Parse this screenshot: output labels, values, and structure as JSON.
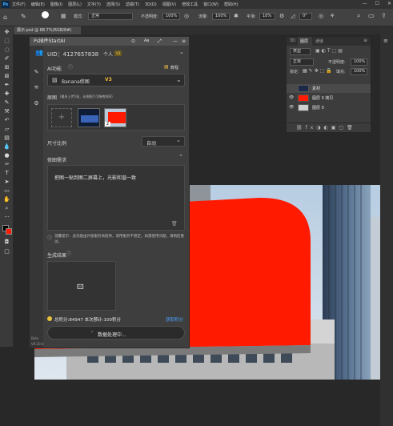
{
  "menubar": {
    "items": [
      "文件(F)",
      "编辑(E)",
      "图像(I)",
      "图层(L)",
      "文字(Y)",
      "选择(S)",
      "滤镜(T)",
      "3D(D)",
      "视图(V)",
      "增效工具",
      "窗口(W)",
      "帮助(H)"
    ],
    "logo": "Ps"
  },
  "options": {
    "mode_label": "模式:",
    "mode_value": "正常",
    "opacity_label": "不透明度:",
    "opacity_value": "100%",
    "flow_label": "流量:",
    "flow_value": "100%",
    "smooth_label": "平滑:",
    "smooth_value": "10%",
    "angle_value": "0°"
  },
  "document": {
    "tab_title": "展示.psd @ 88.7%(RGB/8#)"
  },
  "plugin": {
    "title": "Ps插件StartAI",
    "uid_label": "UID：4127657838",
    "account": "个人",
    "vip_badge": "V3",
    "ai_func_label": "AI功能",
    "tutorial_label": "教程",
    "func_select": "Banana修图",
    "func_badge": "V3",
    "source_label": "原图",
    "source_hint": "(最多上传5张，长按图片可拖拽排序)",
    "thumb2_index": "2",
    "size_label": "尺寸比例",
    "size_value": "自动",
    "prompt_label": "修图需求",
    "prompt_text": "把图一贴到图二屏幕上，光影和谐一致",
    "notice_text": "温馨提示：此功能由外部服务商提供，调用服务不稳定，如遇使用问题，请稍后重试。",
    "result_label": "生成结果",
    "points_text": "总积分:84947  本次预计:100积分",
    "get_points": "获取积分",
    "processing": "数据处理中...",
    "version_top": "Beta",
    "version_bottom": "V9.20.4"
  },
  "layers": {
    "tabs": [
      "3D",
      "图层",
      "通道"
    ],
    "filter_label": "类型",
    "blend_value": "正常",
    "opacity_label": "不透明度:",
    "opacity_value": "100%",
    "lock_label": "锁定:",
    "fill_label": "填充:",
    "fill_value": "100%",
    "rows": [
      {
        "name": "素材"
      },
      {
        "name": "图层 0 拷贝"
      },
      {
        "name": "图层 0"
      }
    ]
  },
  "colors": {
    "accent_red": "#ff1a00",
    "link_blue": "#4aa3ff",
    "ps_blue": "#4fb3ff",
    "coin": "#e8c23a"
  }
}
